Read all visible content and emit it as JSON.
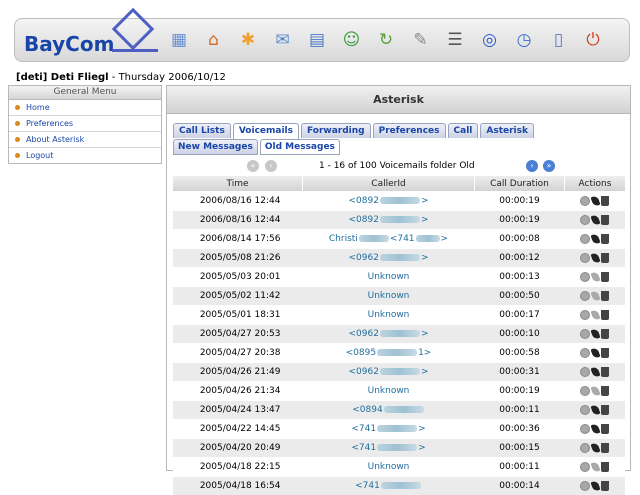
{
  "header": {
    "logo_text": "BayCom",
    "toolbar_icons": [
      "grid-icon",
      "home-icon",
      "asterisk-icon",
      "mail-icon",
      "calendar-icon",
      "users-icon",
      "refresh-icon",
      "tools-icon",
      "tree-icon",
      "compass-icon",
      "clock-icon",
      "book-icon",
      "power-icon"
    ],
    "toolbar_colors": [
      "#6b8fd4",
      "#d26a2a",
      "#f0a030",
      "#5a8ad0",
      "#4a7ac8",
      "#3a9a3a",
      "#5aa040",
      "#888888",
      "#555555",
      "#2a5ac8",
      "#3a6ad0",
      "#5a7ac0",
      "#d04020"
    ],
    "user": "[deti] Deti Fliegl",
    "date_suffix": " - Thursday 2006/10/12"
  },
  "menu": {
    "title": "General Menu",
    "items": [
      "Home",
      "Preferences",
      "About Asterisk",
      "Logout"
    ]
  },
  "panel": {
    "title": "Asterisk",
    "tabs": [
      "Call Lists",
      "Voicemails",
      "Forwarding",
      "Preferences",
      "Call",
      "Asterisk"
    ],
    "active_tab": 1,
    "subtabs": [
      "New Messages",
      "Old Messages"
    ],
    "active_subtab": 1,
    "pager_text": "1 - 16 of 100 Voicemails folder Old",
    "columns": [
      "Time",
      "CallerId",
      "Call Duration",
      "Actions"
    ],
    "rows": [
      {
        "time": "2006/08/16 12:44",
        "caller": [
          "<0892",
          "",
          ">"
        ],
        "duration": "00:00:19"
      },
      {
        "time": "2006/08/16 12:44",
        "caller": [
          "<0892",
          "",
          ">"
        ],
        "duration": "00:00:19"
      },
      {
        "time": "2006/08/14 17:56",
        "caller": [
          "Christi",
          "<741",
          ">"
        ],
        "duration": "00:00:08"
      },
      {
        "time": "2005/05/08 21:26",
        "caller": [
          "<0962",
          "",
          ">"
        ],
        "duration": "00:00:12"
      },
      {
        "time": "2005/05/03 20:01",
        "caller": [
          "Unknown",
          "",
          ""
        ],
        "duration": "00:00:13"
      },
      {
        "time": "2005/05/02 11:42",
        "caller": [
          "Unknown",
          "",
          ""
        ],
        "duration": "00:00:50"
      },
      {
        "time": "2005/05/01 18:31",
        "caller": [
          "Unknown",
          "",
          ""
        ],
        "duration": "00:00:17"
      },
      {
        "time": "2005/04/27 20:53",
        "caller": [
          "<0962",
          "",
          ">"
        ],
        "duration": "00:00:10"
      },
      {
        "time": "2005/04/27 20:38",
        "caller": [
          "<0895",
          "",
          "1>"
        ],
        "duration": "00:00:58"
      },
      {
        "time": "2005/04/26 21:49",
        "caller": [
          "<0962",
          "",
          ">"
        ],
        "duration": "00:00:31"
      },
      {
        "time": "2005/04/26 21:34",
        "caller": [
          "Unknown",
          "",
          ""
        ],
        "duration": "00:00:19"
      },
      {
        "time": "2005/04/24 13:47",
        "caller": [
          "<0894",
          "",
          ""
        ],
        "duration": "00:00:11"
      },
      {
        "time": "2005/04/22 14:45",
        "caller": [
          "<741",
          "",
          ">"
        ],
        "duration": "00:00:36"
      },
      {
        "time": "2005/04/20 20:49",
        "caller": [
          "<741",
          "",
          ">"
        ],
        "duration": "00:00:15"
      },
      {
        "time": "2005/04/18 22:15",
        "caller": [
          "Unknown",
          "",
          ""
        ],
        "duration": "00:00:11"
      },
      {
        "time": "2005/04/18 16:54",
        "caller": [
          "<741",
          "",
          ""
        ],
        "duration": "00:00:14"
      }
    ]
  }
}
